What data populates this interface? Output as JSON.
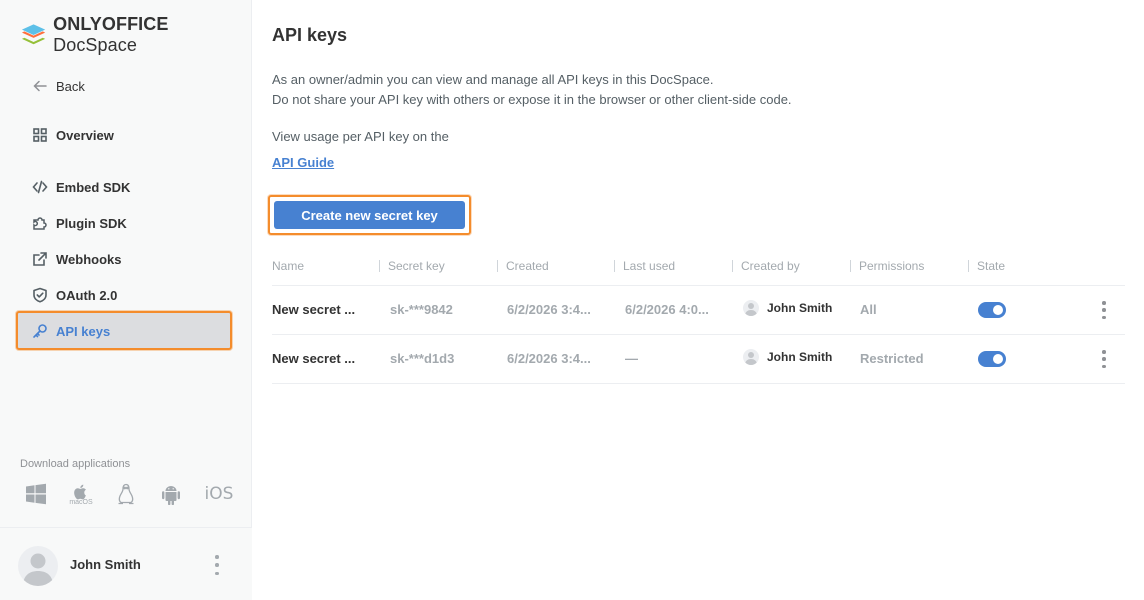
{
  "brand": {
    "name_bold": "ONLYOFFICE",
    "name_regular": " DocSpace"
  },
  "sidebar": {
    "back_label": "Back",
    "items": [
      {
        "label": "Overview",
        "icon": "grid-icon"
      },
      {
        "label": "Embed SDK",
        "icon": "code-icon"
      },
      {
        "label": "Plugin SDK",
        "icon": "puzzle-icon"
      },
      {
        "label": "Webhooks",
        "icon": "external-link-icon"
      },
      {
        "label": "OAuth 2.0",
        "icon": "shield-check-icon"
      },
      {
        "label": "API keys",
        "icon": "key-icon",
        "active": true
      }
    ],
    "download_label": "Download applications",
    "apps": [
      {
        "name": "windows-icon"
      },
      {
        "name": "apple-icon",
        "label": "macOS"
      },
      {
        "name": "linux-icon"
      },
      {
        "name": "android-icon"
      },
      {
        "name": "ios-icon",
        "label": "iOS"
      }
    ]
  },
  "user": {
    "name": "John Smith"
  },
  "main": {
    "title": "API keys",
    "description_line1": "As an owner/admin you can view and manage all API keys in this DocSpace.",
    "description_line2": "Do not share your API key with others or expose it in the browser or other client-side code.",
    "usage_text": "View usage per API key on the",
    "guide_link": "API Guide",
    "create_button": "Create new secret key"
  },
  "table": {
    "headers": [
      "Name",
      "Secret key",
      "Created",
      "Last used",
      "Created by",
      "Permissions",
      "State"
    ],
    "rows": [
      {
        "name": "New secret ...",
        "secret": "sk-***9842",
        "created": "6/2/2026 3:4...",
        "last_used": "6/2/2026 4:0...",
        "created_by": "John Smith",
        "permissions": "All",
        "state_on": true
      },
      {
        "name": "New secret ...",
        "secret": "sk-***d1d3",
        "created": "6/2/2026 3:4...",
        "last_used": "—",
        "created_by": "John Smith",
        "permissions": "Restricted",
        "state_on": true
      }
    ]
  },
  "colors": {
    "accent": "#4781d1",
    "highlight": "#f48c2c",
    "sidebar_bg": "#f8f9f9"
  }
}
